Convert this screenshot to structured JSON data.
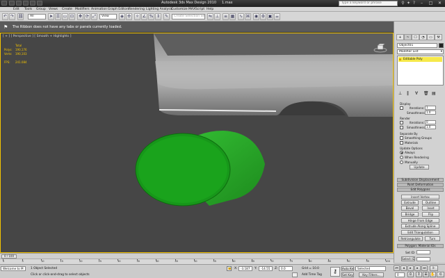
{
  "title_bar": {
    "app_title": "Autodesk 3ds Max Design 2010",
    "file_name": "1.max",
    "search_placeholder": "Type a keyword or phrase"
  },
  "menu": [
    "Edit",
    "Tools",
    "Group",
    "Views",
    "Create",
    "Modifiers",
    "Animation",
    "Graph Editors",
    "Rendering",
    "Lighting Analysis",
    "Customize",
    "MAXScript",
    "Help"
  ],
  "toolbar": {
    "selection_filter": "All",
    "reference_coord": "View",
    "named_selection_placeholder": "Create Selection Set"
  },
  "ribbon": {
    "message": "The Ribbon does not have any tabs or panels currently loaded."
  },
  "viewport": {
    "label": "[ + ] [ Perspective ] [ Smooth + Highlights ]",
    "stats_header": "Total",
    "stats": [
      {
        "label": "Polys:",
        "value": "190,176"
      },
      {
        "label": "Verts:",
        "value": "190,103"
      }
    ],
    "fps_label": "FPS:",
    "fps_value": "241.084",
    "colors": {
      "viewport_bg": "#464646",
      "object": "#2bb02b",
      "active_border": "#f5c400"
    }
  },
  "command_panel": {
    "tabs": [
      "+",
      "~",
      "☐",
      "◔",
      "▭",
      "⚒"
    ],
    "object_name": "Object01",
    "modifier_list": "Modifier List",
    "stack_item": "Editable Poly",
    "display_label": "Display",
    "iterations_label": "Iterations:",
    "iterations_value": "1",
    "smoothness_label": "Smoothness:",
    "smoothness_value": "1.0",
    "render_label": "Render",
    "render_iterations_value": "0",
    "render_smoothness_value": "1.0",
    "separate_by": "Separate By",
    "smoothing_groups": "Smoothing Groups",
    "materials": "Materials",
    "update_options": "Update Options",
    "always": "Always",
    "when_rendering": "When Rendering",
    "manually": "Manually",
    "update_button": "Update",
    "rollouts": [
      "Subdivision Displacement",
      "Paint Deformation",
      "Edit Polygons"
    ],
    "insert_vertex": "Insert Vertex",
    "buttons_row1": [
      "Extrude",
      "Outline"
    ],
    "buttons_row2": [
      "Bevel",
      "Inset"
    ],
    "buttons_row3": [
      "Bridge",
      "Flip"
    ],
    "hinge": "Hinge From Edge",
    "extrude_spline": "Extrude Along Spline",
    "edit_triangulation": "Edit Triangulation",
    "retriangulate": "Retriangulate",
    "turn": "Turn",
    "material_rollout": "Polygon: Material IDs",
    "set_id_label": "Set ID:",
    "select_id_label": "Select ID"
  },
  "timeline": {
    "position": "0 / 100",
    "ticks": [
      "0",
      "5",
      "10",
      "15",
      "20",
      "25",
      "30",
      "35",
      "40",
      "45",
      "50",
      "55",
      "60",
      "65",
      "70",
      "75",
      "80",
      "85",
      "90",
      "95",
      "100"
    ]
  },
  "status": {
    "maxscript": "Welcome to M",
    "selection_info": "1 Object Selected",
    "prompt": "Click or click-and-drag to select objects",
    "x_label": "X:",
    "x_value": "-3.187",
    "y_label": "Y:",
    "y_value": "-14.55",
    "z_label": "Z:",
    "z_value": "0.0",
    "grid": "Grid = 10.0",
    "add_time_tag": "Add Time Tag",
    "auto_key": "Auto Key",
    "set_key": "Set Key",
    "selected": "Selected",
    "key_filters": "Key Filters...",
    "frame": "0"
  }
}
